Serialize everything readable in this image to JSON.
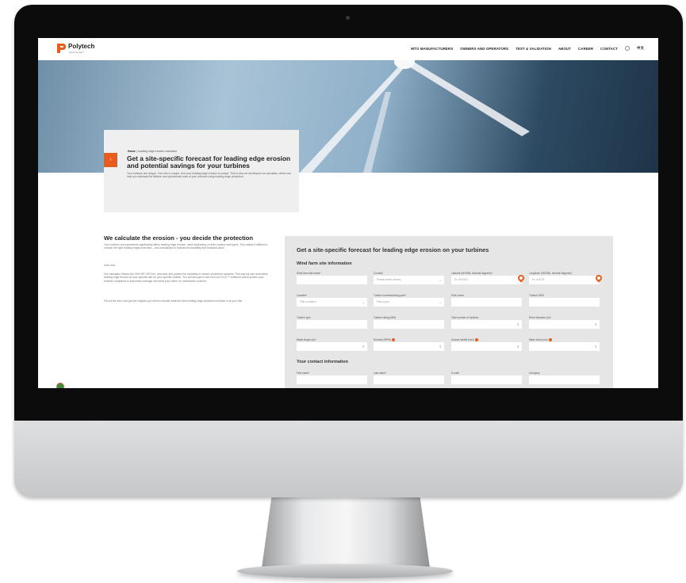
{
  "nav": {
    "logo_text": "Polytech",
    "logo_sub": "strive for life™",
    "items": [
      "WTG MANUFACTURERS",
      "OWNERS AND OPERATORS",
      "TEST & VALIDATION",
      "ABOUT",
      "CAREER",
      "CONTACT"
    ],
    "lang": "中文"
  },
  "hero": {
    "breadcrumb_home": "Home",
    "breadcrumb_current": "Leading edge erosion calculator",
    "title": "Get a site-specific forecast for leading edge erosion and potential savings for your turbines",
    "text": "Your turbines are unique. Your site is unique. And your leading edge erosion is unique. This is why we developed our calculator, which can help you estimate the lifetime and operational costs of your turbines using leading edge protection."
  },
  "intro": {
    "title": "We calculate the erosion - you decide the protection",
    "p1": "Your turbines and operations significantly affect leading edge erosion, wind depending on their location and types. This makes it difficult to choose the right leading edge protection – and constituted to forecast its durability and financial value.",
    "p2": "Until now.",
    "p3": "Our calculator follows the DNV-RP-0573 for, sea area and protect the durability of various protection systems. This way we can accurately leading edge erosion at your specific site for your specific turbine. You will also get to see how our ELLE™ softened would protect your turbines compared to industrial coverage and what your return on investment could be.",
    "p4": "Fill out the form and get the insights you need to decide what the best leading edge protection solution is at your site."
  },
  "form": {
    "title": "Get a site-specific forecast for leading edge erosion on your turbines",
    "section_site": "Wind farm site information",
    "section_contact": "Your contact information",
    "site_fields": [
      {
        "label": "Wind farm site name*",
        "value": ""
      },
      {
        "label": "Country*",
        "value": "Please select country"
      },
      {
        "label": "Latitude (WGS84, decimal degrees)*",
        "value": "Ex. 55.6441"
      },
      {
        "label": "Longitude (WGS84, decimal degrees)*",
        "value": "Ex. 8.6178"
      },
      {
        "label": "Location*",
        "value": "Pick a location"
      },
      {
        "label": "Turbine commissioning year*",
        "value": "Pick a year"
      },
      {
        "label": "Park owner",
        "value": ""
      },
      {
        "label": "Turbine OEM",
        "value": ""
      },
      {
        "label": "Turbine type",
        "value": ""
      },
      {
        "label": "Turbine rating (MW)",
        "value": ""
      },
      {
        "label": "Total number of turbines",
        "value": ""
      },
      {
        "label": "Rotor diameter (m)*",
        "value": ""
      },
      {
        "label": "Blade length (m)*",
        "value": ""
      },
      {
        "label": "Nominal (RPM)",
        "value": ""
      },
      {
        "label": "Annual rainfall (mm)",
        "value": ""
      },
      {
        "label": "Mean wind (m/s)",
        "value": ""
      }
    ],
    "contact_fields": [
      {
        "label": "First name*",
        "value": ""
      },
      {
        "label": "Last name*",
        "value": ""
      },
      {
        "label": "E-mail*",
        "value": ""
      },
      {
        "label": "Company",
        "value": ""
      }
    ]
  },
  "colors": {
    "accent": "#e85d1b",
    "bezel": "#0c0c0d",
    "form_bg": "#e6e6e6"
  }
}
